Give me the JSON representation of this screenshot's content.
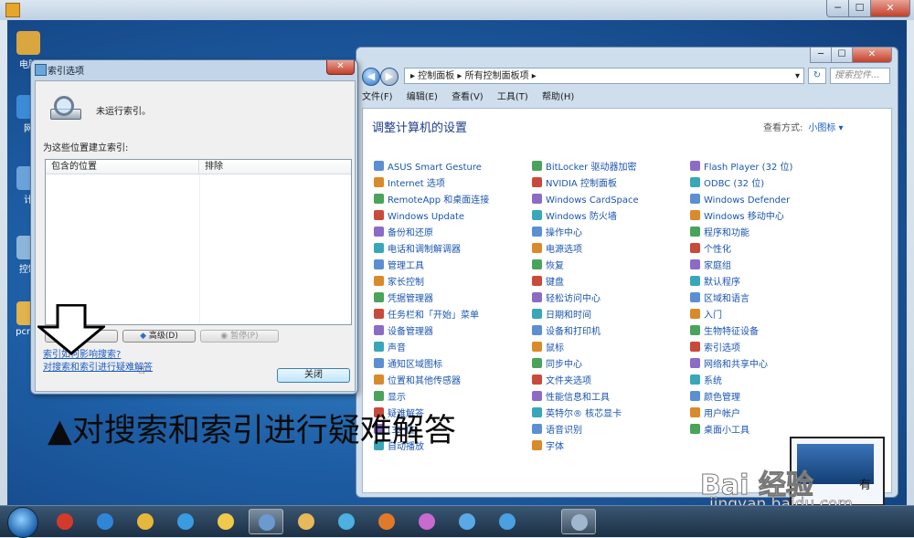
{
  "outer_window": {
    "minimize": "─",
    "maximize": "☐",
    "close": "✕"
  },
  "desktop_icons": [
    {
      "label": "电脑",
      "color": "#d9a640"
    },
    {
      "label": "网",
      "color": "#3c8bd6"
    },
    {
      "label": "计",
      "color": "#6aa3da"
    },
    {
      "label": "控制",
      "color": "#8db5d9"
    },
    {
      "label": "pcma",
      "color": "#e2b24c"
    }
  ],
  "control_panel": {
    "breadcrumb": "▸ 控制面板 ▸ 所有控制面板项 ▸",
    "search_placeholder": "搜索控件...",
    "menu": [
      "文件(F)",
      "编辑(E)",
      "查看(V)",
      "工具(T)",
      "帮助(H)"
    ],
    "heading": "调整计算机的设置",
    "view_by_label": "查看方式:",
    "view_by_value": "小图标 ▾",
    "columns": [
      [
        "ASUS Smart Gesture",
        "Internet 选项",
        "RemoteApp 和桌面连接",
        "Windows Update",
        "备份和还原",
        "电话和调制解调器",
        "管理工具",
        "家长控制",
        "凭据管理器",
        "任务栏和「开始」菜单",
        "设备管理器",
        "声音",
        "通知区域图标",
        "位置和其他传感器",
        "显示",
        "疑难解答",
        "(32 位)",
        "自动播放"
      ],
      [
        "BitLocker 驱动器加密",
        "NVIDIA 控制面板",
        "Windows CardSpace",
        "Windows 防火墙",
        "操作中心",
        "电源选项",
        "恢复",
        "键盘",
        "轻松访问中心",
        "日期和时间",
        "设备和打印机",
        "鼠标",
        "同步中心",
        "文件夹选项",
        "性能信息和工具",
        "英特尔® 核芯显卡",
        "语音识别",
        "字体"
      ],
      [
        "Flash Player (32 位)",
        "ODBC (32 位)",
        "Windows Defender",
        "Windows 移动中心",
        "程序和功能",
        "个性化",
        "家庭组",
        "默认程序",
        "区域和语言",
        "入门",
        "生物特征设备",
        "索引选项",
        "网络和共享中心",
        "系统",
        "颜色管理",
        "用户帐户",
        "桌面小工具"
      ]
    ],
    "icon_colors": [
      "#5b8fd1",
      "#d98a2b",
      "#4aa35a",
      "#c94a3b",
      "#8c6bc7",
      "#3aa7b8"
    ]
  },
  "dialog": {
    "title": "索引选项",
    "close": "✕",
    "status": "未运行索引。",
    "locations_label": "为这些位置建立索引:",
    "col_included": "包含的位置",
    "col_excluded": "排除",
    "btn_modify": "",
    "btn_advanced": "高级(D)",
    "btn_pause": "暂停(P)",
    "link_how": "索引如何影响搜索?",
    "link_troubleshoot": "对搜索和索引进行疑难解答",
    "btn_close": "关闭"
  },
  "caption": "▲对搜索和索引进行疑难解答",
  "watermark": {
    "brand": "Bai 经验",
    "url": "jingyan.baidu.com",
    "tag": "有"
  },
  "taskbar": {
    "items": [
      {
        "name": "wps",
        "color": "#d43a2b",
        "active": false
      },
      {
        "name": "ie",
        "color": "#2f86d6",
        "active": false
      },
      {
        "name": "chrome",
        "color": "#e6b73a",
        "active": false
      },
      {
        "name": "app",
        "color": "#3a9be0",
        "active": false
      },
      {
        "name": "stickynotes",
        "color": "#f0c94a",
        "active": false
      },
      {
        "name": "control-panel",
        "color": "#6a9ad0",
        "active": true
      },
      {
        "name": "explorer",
        "color": "#e7b959",
        "active": false
      },
      {
        "name": "pinwheel",
        "color": "#4cb0e0",
        "active": false
      },
      {
        "name": "media",
        "color": "#e07a2a",
        "active": false
      },
      {
        "name": "paint",
        "color": "#c86ad0",
        "active": false
      },
      {
        "name": "network",
        "color": "#5aa9e6",
        "active": false
      },
      {
        "name": "windows",
        "color": "#4aa0e0",
        "active": false
      },
      {
        "name": "index",
        "color": "#9fb7cf",
        "active": true
      }
    ]
  }
}
